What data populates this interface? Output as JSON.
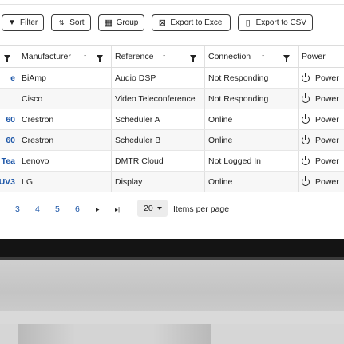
{
  "toolbar": {
    "filter_label": "Filter",
    "sort_label": "Sort",
    "group_label": "Group",
    "export_excel_label": "Export to Excel",
    "export_csv_label": "Export to CSV"
  },
  "table": {
    "headers": {
      "manufacturer": "Manufacturer",
      "reference": "Reference",
      "connection": "Connection",
      "power": "Power"
    },
    "rows": [
      {
        "name": "e",
        "manufacturer": "BiAmp",
        "reference": "Audio DSP",
        "connection": "Not Responding",
        "power": "Power"
      },
      {
        "name": "",
        "manufacturer": "Cisco",
        "reference": "Video Teleconference",
        "connection": "Not Responding",
        "power": "Power"
      },
      {
        "name": "60",
        "manufacturer": "Crestron",
        "reference": "Scheduler A",
        "connection": "Online",
        "power": "Power"
      },
      {
        "name": "60",
        "manufacturer": "Crestron",
        "reference": "Scheduler B",
        "connection": "Online",
        "power": "Power"
      },
      {
        "name": "Tea",
        "manufacturer": "Lenovo",
        "reference": "DMTR Cloud",
        "connection": "Not Logged In",
        "power": "Power"
      },
      {
        "name": "UV3",
        "manufacturer": "LG",
        "reference": "Display",
        "connection": "Online",
        "power": "Power"
      }
    ]
  },
  "pager": {
    "pages": [
      "3",
      "4",
      "5",
      "6"
    ],
    "next_glyph": "▸",
    "last_glyph": "▸|",
    "page_size": "20",
    "items_per_page_label": "Items per page"
  },
  "colors": {
    "link_blue": "#1e57a8",
    "bezel": "#141414",
    "frame": "#cfcfcf"
  }
}
